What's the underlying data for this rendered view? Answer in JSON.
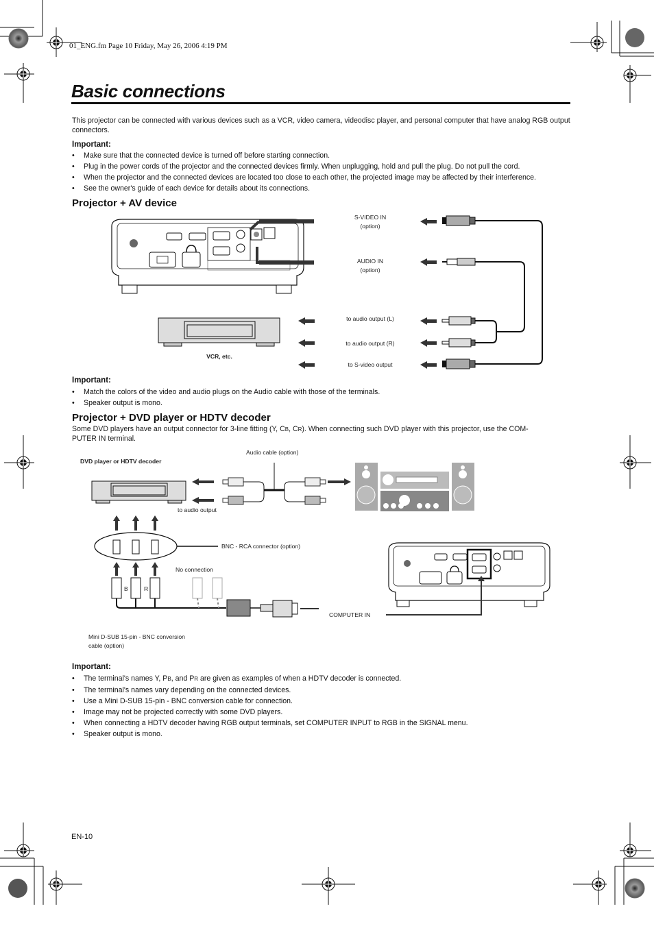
{
  "print_header": "01_ENG.fm  Page 10  Friday, May 26, 2006  4:19 PM",
  "page_title": "Basic connections",
  "intro": "This projector can be connected with various devices such as a VCR, video camera, videodisc player, and personal computer that have analog RGB output connectors.",
  "important_1": {
    "heading": "Important:",
    "items": [
      "Make sure that the connected device is turned off before starting connection.",
      "Plug in the power cords of the projector and the connected devices firmly. When unplugging, hold and pull the plug. Do not pull the cord.",
      "When the projector and the connected devices are located too close to each other, the projected image may be affected by their interference.",
      "See the owner's guide of each device for details about its connections."
    ]
  },
  "section_av": {
    "heading": "Projector + AV device",
    "labels": {
      "svideo_in": "S-VIDEO IN",
      "svideo_in_note": "(option)",
      "audio_in": "AUDIO IN",
      "audio_in_note": "(option)",
      "audio_out_l": "to audio output (L)",
      "audio_out_r": "to audio output (R)",
      "svideo_out": "to S-video output",
      "vcr": "VCR, etc."
    },
    "icons": [
      "projector-rear-icon",
      "vcr-icon",
      "s-video-plug-icon",
      "mini-plug-icon",
      "rca-plug-icon",
      "arrow-left-icon"
    ]
  },
  "important_2": {
    "heading": "Important:",
    "items": [
      "Match the colors of the video and audio plugs on the Audio cable with those of the terminals.",
      "Speaker output is mono."
    ]
  },
  "section_dvd": {
    "heading": "Projector + DVD player or HDTV decoder",
    "intro_line1_a": "Some DVD players have an output connector for 3-line fitting (Y, C",
    "intro_sub_b": "B",
    "intro_mid": ", C",
    "intro_sub_r": "R",
    "intro_line1_b": "). When connecting such DVD player with this projector, use the COM-",
    "intro_line2": "PUTER IN terminal.",
    "labels": {
      "audio_cable": "Audio cable (option)",
      "dvd_player": "DVD player or HDTV decoder",
      "to_audio_output": "to audio output",
      "bnc_rca": "BNC - RCA connector (option)",
      "no_connection": "No connection",
      "bnc_b": "B",
      "bnc_r": "R",
      "computer_in": "COMPUTER IN",
      "conversion_cable_1": "Mini D-SUB 15-pin - BNC conversion",
      "conversion_cable_2": "cable (option)"
    },
    "icons": [
      "dvd-player-icon",
      "audio-system-icon",
      "speaker-icon",
      "bnc-plug-icon",
      "dsub-plug-icon",
      "projector-rear-icon"
    ]
  },
  "important_3": {
    "heading": "Important:",
    "items": [
      {
        "a": "The terminal's names Y, P",
        "s1": "B",
        "b": ", and P",
        "s2": "R",
        "c": " are given as examples of when a HDTV decoder is connected."
      },
      "The terminal's names vary depending on the connected devices.",
      "Use a Mini D-SUB 15-pin - BNC conversion cable for connection.",
      "Image may not be projected correctly with some DVD players.",
      "When connecting a HDTV decoder having RGB output terminals, set COMPUTER INPUT to RGB in the SIGNAL menu.",
      "Speaker output is mono."
    ]
  },
  "footer": {
    "page_number": "EN-10"
  }
}
